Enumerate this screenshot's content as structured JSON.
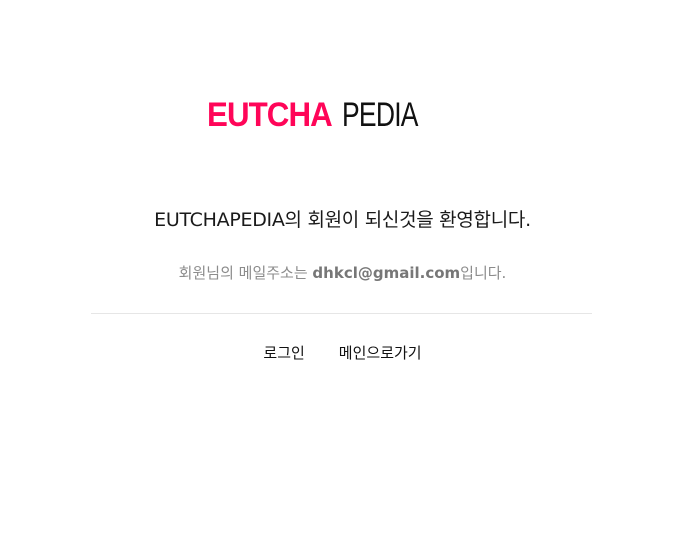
{
  "logo": {
    "accent_text": "EUTCHA",
    "dark_text": "PEDIA",
    "accent_color": "#ff0558",
    "dark_color": "#111111"
  },
  "welcome_message": "EUTCHAPEDIA의 회원이 되신것을 환영합니다.",
  "email_line": {
    "prefix": "회원님의 메일주소는 ",
    "email": "dhkcl@gmail.com",
    "suffix": "입니다."
  },
  "links": {
    "login": "로그인",
    "go_main": "메인으로가기"
  }
}
